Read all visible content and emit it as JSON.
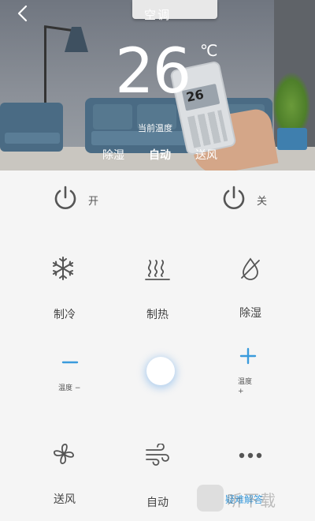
{
  "header": {
    "title": "空调",
    "temperature": "26",
    "temperature_unit": "℃",
    "temperature_label": "当前温度",
    "modes": [
      "除湿",
      "自动",
      "送风"
    ],
    "active_mode": "自动",
    "remote_screen_value": "26"
  },
  "power": {
    "on_label": "开",
    "off_label": "关"
  },
  "modes_grid": {
    "cool_label": "制冷",
    "heat_label": "制热",
    "dehumidify_label": "除湿"
  },
  "temperature_controls": {
    "decrease_symbol": "−",
    "decrease_label": "温度 −",
    "increase_symbol": "+",
    "increase_label_line1": "温度",
    "increase_label_line2": "+"
  },
  "bottom_row": {
    "fan_label": "送风",
    "auto_label": "自动",
    "faq_label": "疑难解答"
  },
  "watermark": {
    "text": "听下载"
  },
  "colors": {
    "accent": "#3a9bdc",
    "icon": "#555555",
    "background": "#f5f5f5"
  }
}
